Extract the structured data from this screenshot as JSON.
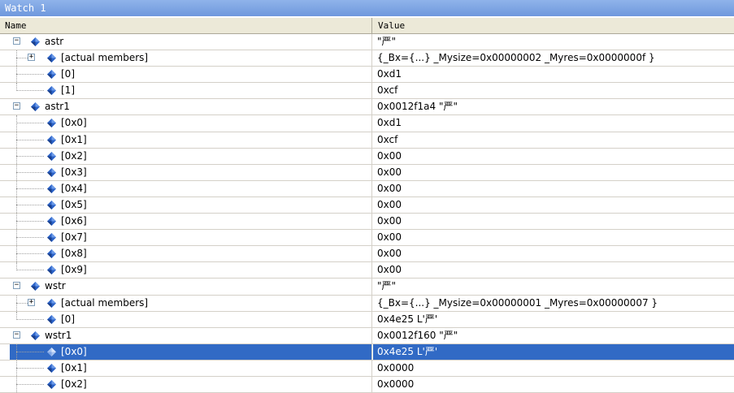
{
  "window": {
    "title": "Watch 1"
  },
  "columns": {
    "name": "Name",
    "value": "Value"
  },
  "rows": [
    {
      "level": 0,
      "expander": "−",
      "name": "astr",
      "value": "\"严\""
    },
    {
      "level": 1,
      "expander": "+",
      "name": "[actual members]",
      "value": "{_Bx={...} _Mysize=0x00000002 _Myres=0x0000000f }"
    },
    {
      "level": 1,
      "expander": "",
      "name": "[0]",
      "value": "0xd1"
    },
    {
      "level": 1,
      "expander": "",
      "name": "[1]",
      "value": "0xcf",
      "last": true
    },
    {
      "level": 0,
      "expander": "−",
      "name": "astr1",
      "value": "0x0012f1a4 \"严\""
    },
    {
      "level": 1,
      "expander": "",
      "name": "[0x0]",
      "value": "0xd1"
    },
    {
      "level": 1,
      "expander": "",
      "name": "[0x1]",
      "value": "0xcf"
    },
    {
      "level": 1,
      "expander": "",
      "name": "[0x2]",
      "value": "0x00"
    },
    {
      "level": 1,
      "expander": "",
      "name": "[0x3]",
      "value": "0x00"
    },
    {
      "level": 1,
      "expander": "",
      "name": "[0x4]",
      "value": "0x00"
    },
    {
      "level": 1,
      "expander": "",
      "name": "[0x5]",
      "value": "0x00"
    },
    {
      "level": 1,
      "expander": "",
      "name": "[0x6]",
      "value": "0x00"
    },
    {
      "level": 1,
      "expander": "",
      "name": "[0x7]",
      "value": "0x00"
    },
    {
      "level": 1,
      "expander": "",
      "name": "[0x8]",
      "value": "0x00"
    },
    {
      "level": 1,
      "expander": "",
      "name": "[0x9]",
      "value": "0x00",
      "last": true
    },
    {
      "level": 0,
      "expander": "−",
      "name": "wstr",
      "value": "\"严\""
    },
    {
      "level": 1,
      "expander": "+",
      "name": "[actual members]",
      "value": "{_Bx={...} _Mysize=0x00000001 _Myres=0x00000007 }"
    },
    {
      "level": 1,
      "expander": "",
      "name": "[0]",
      "value": "0x4e25 L'严'",
      "last": true
    },
    {
      "level": 0,
      "expander": "−",
      "name": "wstr1",
      "value": "0x0012f160 \"严\""
    },
    {
      "level": 1,
      "expander": "",
      "name": "[0x0]",
      "value": "0x4e25 L'严'",
      "selected": true
    },
    {
      "level": 1,
      "expander": "",
      "name": "[0x1]",
      "value": "0x0000"
    },
    {
      "level": 1,
      "expander": "",
      "name": "[0x2]",
      "value": "0x0000"
    }
  ],
  "icons": {
    "variable": "variable-gem-icon",
    "collapse": "minus-box-icon",
    "expand": "plus-box-icon"
  },
  "colors": {
    "selection": "#316ac5",
    "title_bar": "#7ea5e6",
    "gem": "#2a62c8"
  }
}
